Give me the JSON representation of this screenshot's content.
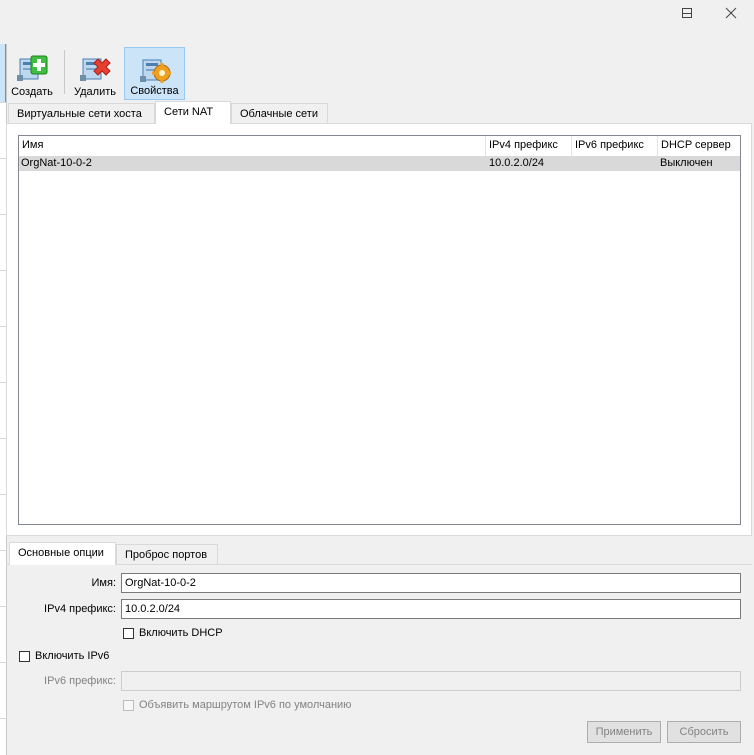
{
  "window": {
    "minimize_glyph": "—",
    "maximize_glyph": "☐",
    "close_glyph": "✕"
  },
  "toolbar": {
    "create_label": "Создать",
    "delete_label": "Удалить",
    "properties_label": "Свойства",
    "create_icon": "network-add-icon",
    "delete_icon": "network-remove-icon",
    "properties_icon": "network-properties-icon"
  },
  "tabs": [
    {
      "label": "Виртуальные сети хоста"
    },
    {
      "label": "Сети NAT",
      "active": true
    },
    {
      "label": "Облачные сети"
    }
  ],
  "table": {
    "sort_indicator": "^",
    "columns": [
      "Имя",
      "IPv4 префикс",
      "IPv6 префикс",
      "DHCP сервер"
    ],
    "rows": [
      {
        "name": "OrgNat-10-0-2",
        "ipv4": "10.0.2.0/24",
        "ipv6": "",
        "dhcp": "Выключен"
      }
    ]
  },
  "detail_tabs": [
    {
      "label": "Основные опции",
      "active": true
    },
    {
      "label": "Проброс портов"
    }
  ],
  "form": {
    "name_label": "Имя:",
    "name_value": "OrgNat-10-0-2",
    "ipv4_label": "IPv4 префикс:",
    "ipv4_value": "10.0.2.0/24",
    "enable_dhcp_label": "Включить DHCP",
    "enable_dhcp_checked": false,
    "enable_ipv6_label": "Включить IPv6",
    "enable_ipv6_checked": false,
    "ipv6_label": "IPv6 префикс:",
    "ipv6_value": "",
    "advertise_ipv6_label": "Объявить маршрутом IPv6 по умолчанию",
    "advertise_ipv6_checked": false
  },
  "buttons": {
    "apply_label": "Применить",
    "reset_label": "Сбросить"
  },
  "colors": {
    "selected_row": "#d9d9d9",
    "active_tool": "#cce4f7",
    "add_green": "#3fbf3f",
    "remove_red": "#e8402f",
    "gear_orange": "#f0a020"
  }
}
